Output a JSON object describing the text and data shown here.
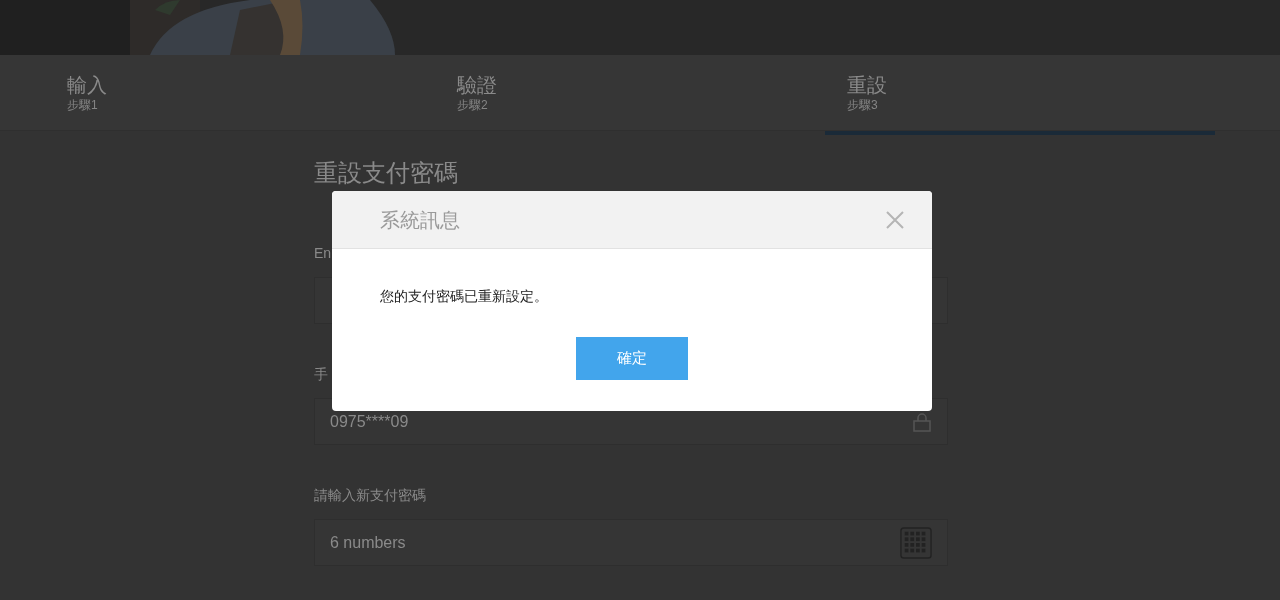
{
  "steps": [
    {
      "title": "輸入",
      "subtitle": "步驟1",
      "selected": false
    },
    {
      "title": "驗證",
      "subtitle": "步驟2",
      "selected": false
    },
    {
      "title": "重設",
      "subtitle": "步驟3",
      "selected": true
    }
  ],
  "form": {
    "heading": "重設支付密碼",
    "fields": [
      {
        "label": "En",
        "kind": "plain"
      },
      {
        "label": "手",
        "value": "0975****09",
        "kind": "locked"
      },
      {
        "label": "請輸入新支付密碼",
        "placeholder": "6 numbers",
        "kind": "keypad"
      }
    ]
  },
  "dialog": {
    "title": "系統訊息",
    "message": "您的支付密碼已重新設定。",
    "confirm": "確定"
  }
}
